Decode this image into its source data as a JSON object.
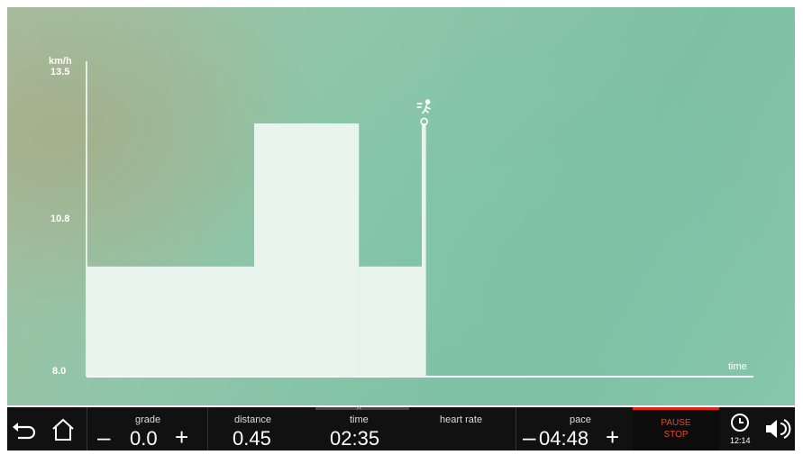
{
  "chart_data": {
    "type": "area",
    "ylabel": "km/h",
    "xlabel": "time",
    "y_ticks": [
      "13.5",
      "10.8",
      "8.0"
    ],
    "ylim": [
      8.0,
      13.5
    ],
    "segments": [
      {
        "start": 0,
        "end": 4,
        "value": 10.0
      },
      {
        "start": 4,
        "end": 6.5,
        "value": 12.6
      },
      {
        "start": 6.5,
        "end": 8,
        "value": 10.0
      },
      {
        "start": 8,
        "end": 8.1,
        "value": 12.6
      }
    ],
    "current_value": 12.6
  },
  "icons": {
    "back": "back-arrow-icon",
    "home": "home-icon",
    "runner": "runner-icon",
    "clock": "clock-icon",
    "volume": "volume-icon",
    "expand": "chevron-up-icon"
  },
  "bottom_bar": {
    "grade": {
      "label": "grade",
      "value": "0.0",
      "minus": "–",
      "plus": "+"
    },
    "distance": {
      "label": "distance",
      "value": "0.45"
    },
    "time": {
      "label": "time",
      "value": "02:35",
      "arrow": "^"
    },
    "heart_rate": {
      "label": "heart rate",
      "value": ""
    },
    "pace": {
      "label": "pace",
      "value": "04:48",
      "minus": "–",
      "plus": "+"
    },
    "pause": {
      "line1": "PAUSE",
      "line2": "STOP"
    },
    "clock_time": "12:14"
  },
  "colors": {
    "fill": "#eaf4ef",
    "pause_accent": "#d8261c",
    "pause_text": "#e04a2a"
  }
}
